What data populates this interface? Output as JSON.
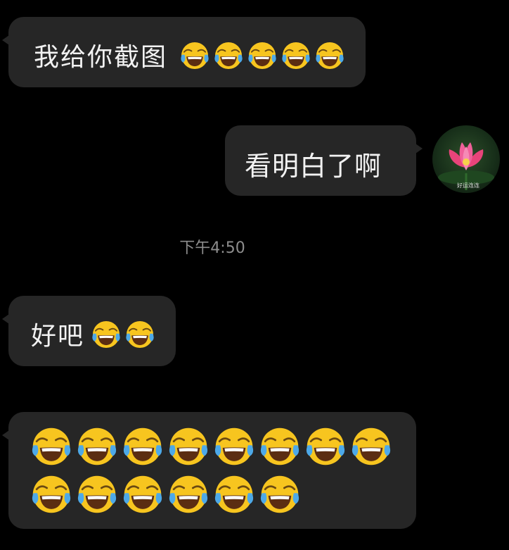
{
  "messages": [
    {
      "side": "left",
      "text": "我给你截图",
      "emoji_count": 5,
      "emoji": "face-with-tears-of-joy"
    },
    {
      "side": "right",
      "text": "看明白了啊"
    },
    {
      "side": "left",
      "text": "好吧",
      "emoji_count": 2,
      "emoji": "face-with-tears-of-joy"
    },
    {
      "side": "left",
      "text": "",
      "emoji_count": 14,
      "emoji": "face-with-tears-of-joy"
    }
  ],
  "timestamp": "下午4:50",
  "avatar": {
    "caption": "好运连连",
    "image": "pink-lotus-flower"
  },
  "colors": {
    "background": "#000000",
    "bubble": "#262626",
    "text": "#f2f2f2",
    "timestamp": "#8d8d8d"
  }
}
